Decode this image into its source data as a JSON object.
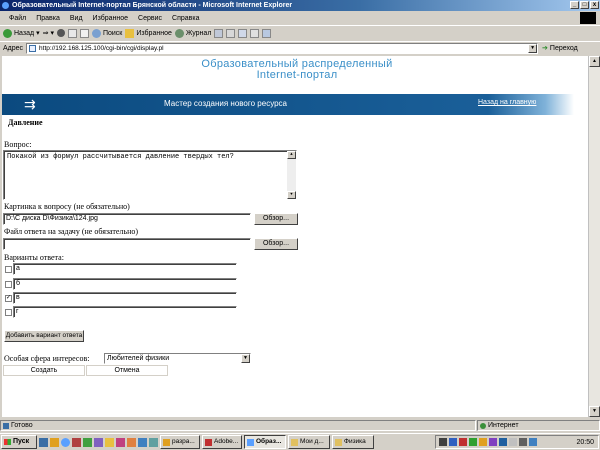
{
  "window": {
    "title": "Образовательный Internet-портал Брянской области - Microsoft Internet Explorer",
    "controls": [
      "_",
      "□",
      "x"
    ]
  },
  "menu": [
    "Файл",
    "Правка",
    "Вид",
    "Избранное",
    "Сервис",
    "Справка"
  ],
  "toolbar": {
    "back": "Назад",
    "search": "Поиск",
    "favorites": "Избранное",
    "history": "Журнал"
  },
  "address": {
    "label": "Адрес",
    "url": "http://192.168.125.100/cgi-bin/cgi/display.pl",
    "go": "Переход"
  },
  "page": {
    "portal_title_line1": "Образовательный распределенный",
    "portal_title_line2": "Internet-портал",
    "banner_text": "Мастер создания нового ресурса",
    "back_link": "Назад на главную",
    "heading": "Давление",
    "question_label": "Вопрос:",
    "question_text": "Покакой из формул рассчитывается давление твердых тел?",
    "picture_label": "Картинка к вопросу (не обязательно)",
    "picture_value": "D:\\С диска D\\Физика\\124.jpg",
    "browse_label": "Обзор...",
    "answer_file_label": "Файл ответа на задачу (не обязательно)",
    "answer_file_value": "",
    "options_label": "Варианты ответа:",
    "options": [
      {
        "text": "а",
        "checked": false
      },
      {
        "text": "б",
        "checked": false
      },
      {
        "text": "в",
        "checked": true
      },
      {
        "text": "г",
        "checked": false
      }
    ],
    "add_option": "Добавить вариант ответа",
    "interest_label": "Особая сфера интересов:",
    "interest_value": "Любителей физики",
    "create": "Создать",
    "cancel": "Отмена"
  },
  "status": {
    "left": "Готово",
    "right": "Интернет"
  },
  "taskbar": {
    "start": "Пуск",
    "tasks": [
      "разра...",
      "Adobe...",
      "Образ...",
      "Мои д...",
      "Физика"
    ],
    "active_index": 2,
    "clock": "20:50"
  }
}
